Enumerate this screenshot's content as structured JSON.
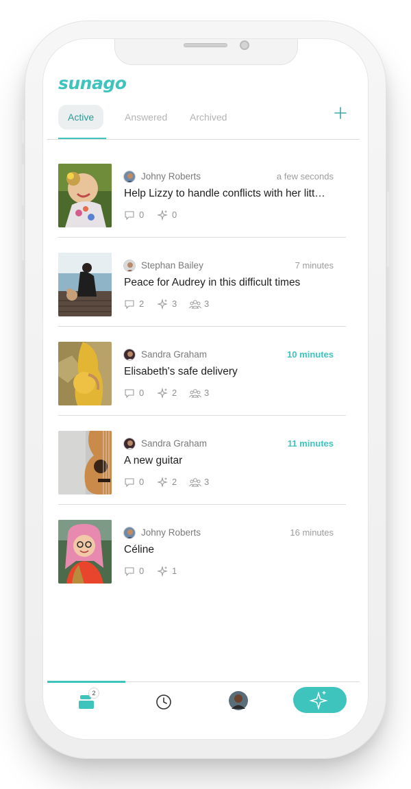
{
  "app": {
    "logo_text": "sunago",
    "accent_color": "#3ec4bd"
  },
  "tabs": [
    {
      "label": "Active",
      "selected": true
    },
    {
      "label": "Answered",
      "selected": false
    },
    {
      "label": "Archived",
      "selected": false
    }
  ],
  "header": {
    "add_icon": "plus-icon"
  },
  "requests": [
    {
      "author": "Johny Roberts",
      "time": "a few seconds",
      "time_highlight": false,
      "title": "Help Lizzy to handle conflicts with her litt…",
      "comments": "0",
      "prayers": "0",
      "participants": null
    },
    {
      "author": "Stephan Bailey",
      "time": "7 minutes",
      "time_highlight": false,
      "title": "Peace for Audrey in this difficult times",
      "comments": "2",
      "prayers": "3",
      "participants": "3"
    },
    {
      "author": "Sandra Graham",
      "time": "10 minutes",
      "time_highlight": true,
      "title": "Elisabeth's safe delivery",
      "comments": "0",
      "prayers": "2",
      "participants": "3"
    },
    {
      "author": "Sandra Graham",
      "time": "11 minutes",
      "time_highlight": true,
      "title": "A new guitar",
      "comments": "0",
      "prayers": "2",
      "participants": "3"
    },
    {
      "author": "Johny Roberts",
      "time": "16 minutes",
      "time_highlight": false,
      "title": "Céline",
      "comments": "0",
      "prayers": "1",
      "participants": null
    }
  ],
  "bottom_nav": {
    "inbox_badge": "2",
    "items": [
      "inbox-stack-icon",
      "clock-icon",
      "profile-avatar",
      "sparkle-icon"
    ]
  }
}
